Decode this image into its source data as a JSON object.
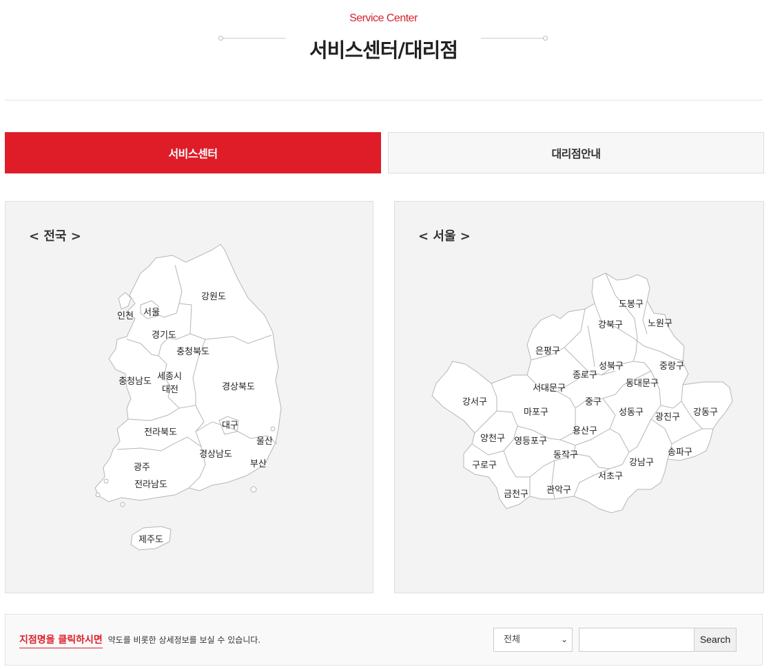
{
  "header": {
    "subtitle": "Service Center",
    "title": "서비스센터/대리점"
  },
  "tabs": [
    {
      "label": "서비스센터",
      "active": true
    },
    {
      "label": "대리점안내",
      "active": false
    }
  ],
  "colors": {
    "accent": "#de1d29",
    "panel_bg": "#f3f3f3",
    "region_fill": "#ffffff",
    "region_stroke": "#b5b5b5"
  },
  "national_map": {
    "title": "< 전국 >",
    "regions": [
      "강원도",
      "서울",
      "인천",
      "경기도",
      "충청북도",
      "세종시",
      "대전",
      "충청남도",
      "경상북도",
      "대구",
      "전라북도",
      "울산",
      "경상남도",
      "부산",
      "광주",
      "전라남도",
      "제주도"
    ]
  },
  "seoul_map": {
    "title": "< 서울 >",
    "districts": [
      "도봉구",
      "강북구",
      "노원구",
      "은평구",
      "성북구",
      "종로구",
      "중랑구",
      "동대문구",
      "서대문구",
      "강서구",
      "중구",
      "마포구",
      "성동구",
      "광진구",
      "강동구",
      "용산구",
      "양천구",
      "영등포구",
      "송파구",
      "동작구",
      "강남구",
      "구로구",
      "서초구",
      "관악구",
      "금천구"
    ]
  },
  "footer": {
    "notice_highlight": "지점명을 클릭하시면",
    "notice_text": "약도를 비롯한 상세정보를 보실 수 있습니다.",
    "select_value": "전체",
    "search_placeholder": "",
    "search_button": "Search"
  }
}
